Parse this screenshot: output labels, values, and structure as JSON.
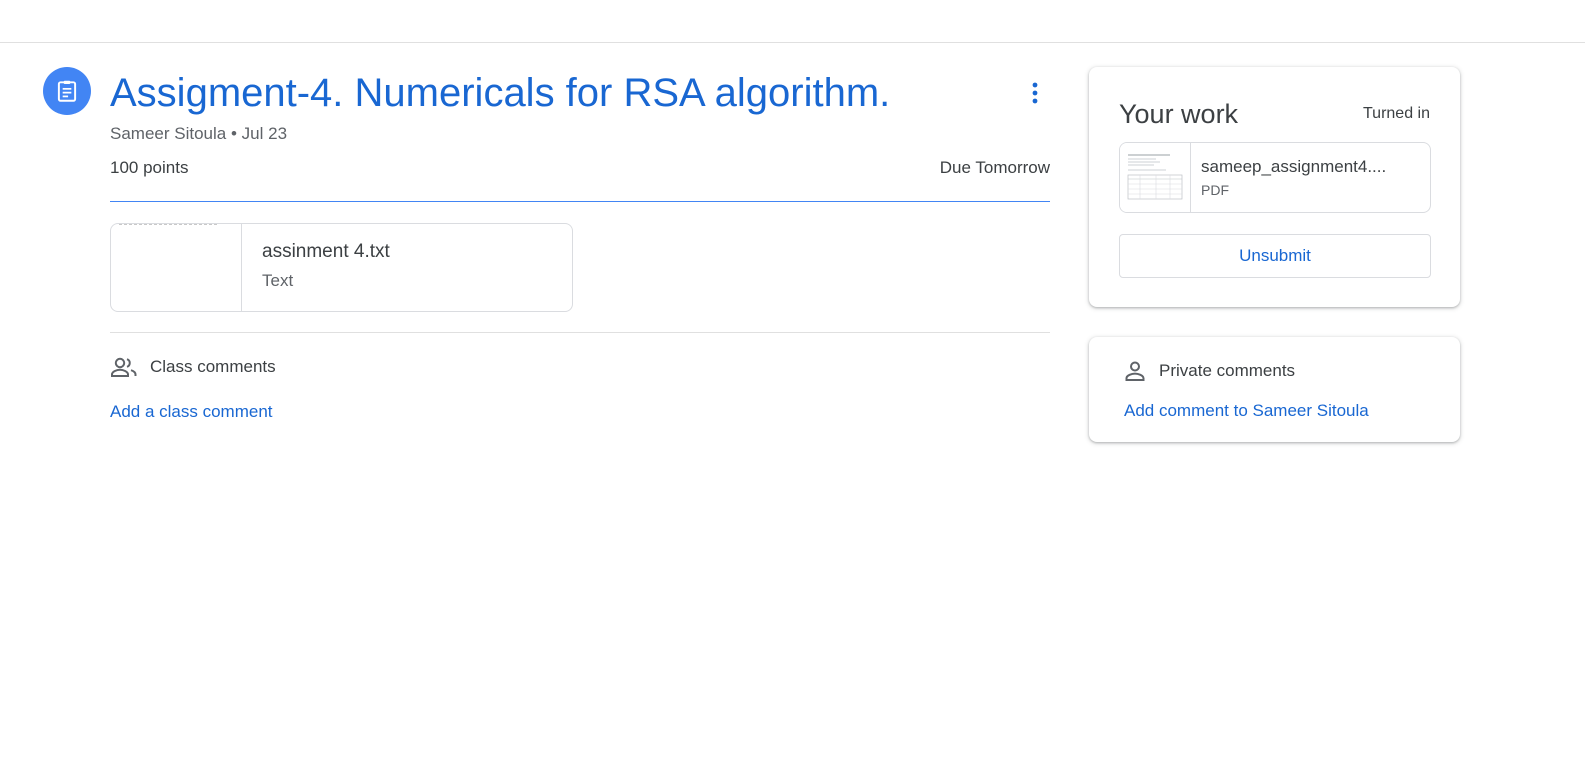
{
  "assignment": {
    "title": "Assigment-4. Numericals for RSA algorithm.",
    "author": "Sameer Sitoula",
    "separator": "•",
    "date": "Jul 23",
    "points": "100 points",
    "due": "Due Tomorrow",
    "icon": "assignment-icon",
    "accent_color": "#1967d2",
    "icon_bg_color": "#4285f4"
  },
  "attachment": {
    "name": "assinment 4.txt",
    "type": "Text"
  },
  "class_comments": {
    "label": "Class comments",
    "add_label": "Add a class comment",
    "icon": "people-icon"
  },
  "your_work": {
    "title": "Your work",
    "status": "Turned in",
    "file": {
      "name": "sameep_assignment4....",
      "type": "PDF"
    },
    "unsubmit_label": "Unsubmit"
  },
  "private_comments": {
    "label": "Private comments",
    "add_label": "Add comment to Sameer Sitoula",
    "icon": "person-icon"
  }
}
